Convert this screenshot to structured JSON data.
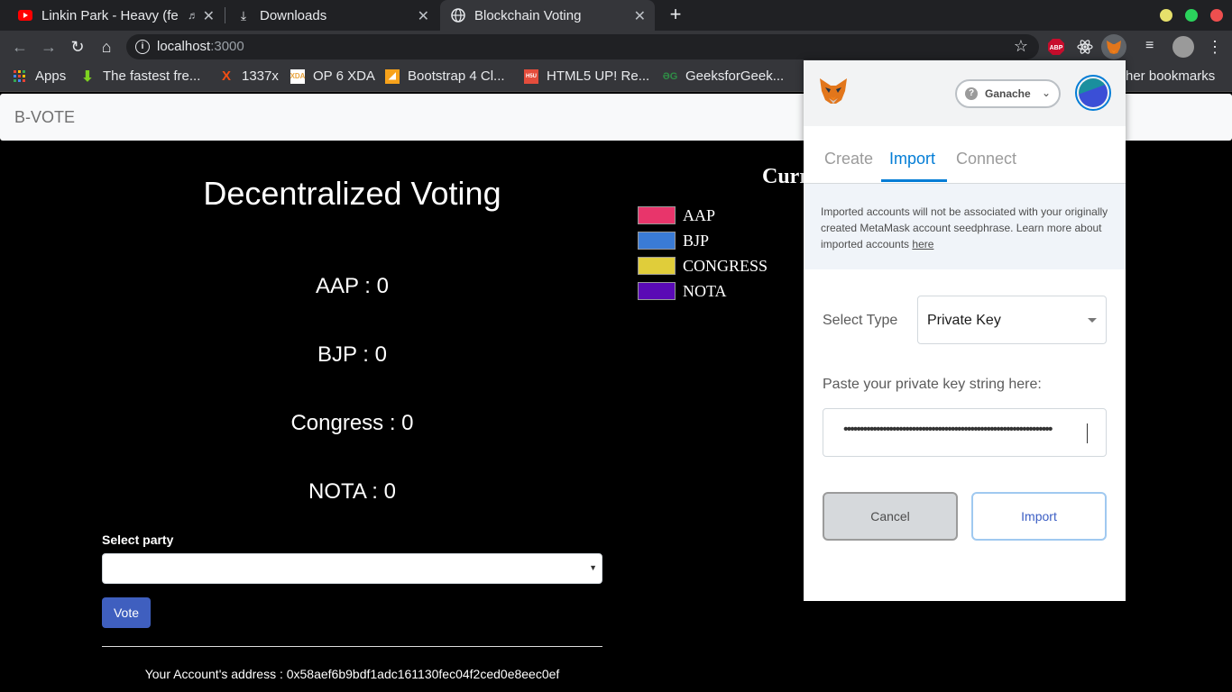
{
  "browser": {
    "tabs": [
      {
        "title": "Linkin Park - Heavy (fe"
      },
      {
        "title": "Downloads"
      },
      {
        "title": "Blockchain Voting"
      }
    ],
    "url_host": "localhost",
    "url_port": ":3000",
    "bookmarks": [
      {
        "label": "Apps"
      },
      {
        "label": "The fastest fre..."
      },
      {
        "label": "1337x"
      },
      {
        "label": "OP 6 XDA"
      },
      {
        "label": "Bootstrap 4 Cl..."
      },
      {
        "label": "HTML5 UP! Re..."
      },
      {
        "label": "GeeksforGeek..."
      },
      {
        "label": "her bookmarks"
      }
    ],
    "extension_abp": "ABP"
  },
  "app": {
    "brand": "B-VOTE",
    "title": "Decentralized Voting",
    "counts": [
      {
        "label": "AAP : 0"
      },
      {
        "label": "BJP : 0"
      },
      {
        "label": "Congress : 0"
      },
      {
        "label": "NOTA : 0"
      }
    ],
    "select_label": "Select party",
    "vote_label": "Vote",
    "account_address": "Your Account's address : 0x58aef6b9bdf1adc161130fec04f2ced0e8eec0ef"
  },
  "chart": {
    "title_visible": "Curr",
    "legend": [
      {
        "label": "AAP",
        "color": "#e8356b"
      },
      {
        "label": "BJP",
        "color": "#3a7bd5"
      },
      {
        "label": "CONGRESS",
        "color": "#e0cd3a"
      },
      {
        "label": "NOTA",
        "color": "#5a0ab5"
      }
    ]
  },
  "metamask": {
    "network": "Ganache",
    "tabs": [
      {
        "label": "Create"
      },
      {
        "label": "Import"
      },
      {
        "label": "Connect"
      }
    ],
    "notice": "Imported accounts will not be associated with your originally created MetaMask account seedphrase. Learn more about imported accounts ",
    "notice_link": "here",
    "select_type_label": "Select Type",
    "select_type_value": "Private Key",
    "key_label": "Paste your private key string here:",
    "key_value_masked": "••••••••••••••••••••••••••••••••••••••••••••••••••••••••••••••••",
    "cancel_label": "Cancel",
    "import_label": "Import"
  }
}
